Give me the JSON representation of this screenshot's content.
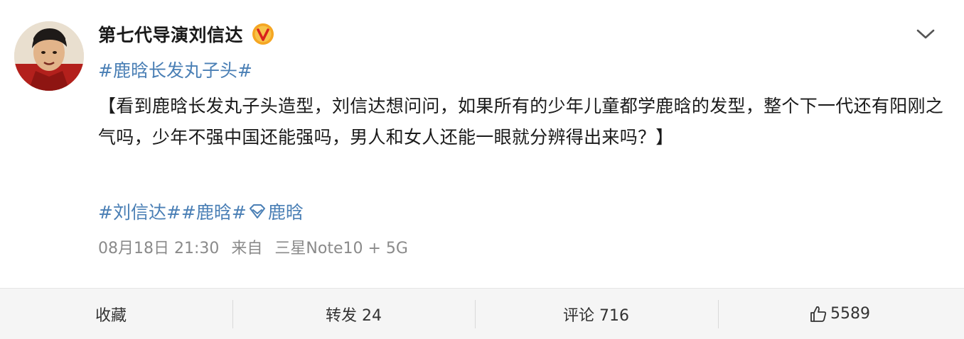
{
  "post": {
    "author": {
      "name": "第七代导演刘信达",
      "verified_icon": "verified-v-badge-icon",
      "avatar_icon": "avatar"
    },
    "topic": "#鹿晗长发丸子头#",
    "content": "【看到鹿晗长发丸子头造型，刘信达想问问，如果所有的少年儿童都学鹿晗的发型，整个下一代还有阳刚之气吗，少年不强中国还能强吗，男人和女人还能一眼就分辨得出来吗？】",
    "tags": {
      "tag1": "#刘信达#",
      "tag2": "#鹿晗#",
      "location_icon": "super-topic-icon",
      "tag3": "鹿晗"
    },
    "meta": {
      "time": "08月18日 21:30",
      "source_prefix": "来自",
      "source": "三星Note10 +  5G"
    }
  },
  "actions": {
    "favorite": "收藏",
    "repost": "转发 24",
    "comment": "评论 716",
    "like": "5589"
  },
  "colors": {
    "link": "#4a7fb5",
    "text": "#1a1a1a",
    "meta": "#8a8a8a",
    "badge": "#f5a623"
  }
}
